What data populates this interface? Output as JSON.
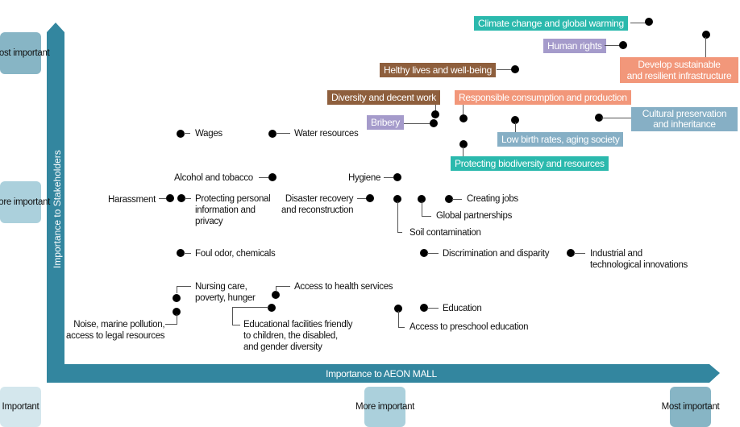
{
  "axes": {
    "y_label": "Importance to Stakeholders",
    "x_label": "Importance to AEON MALL",
    "y_levels": [
      "Most important",
      "More important",
      "Important"
    ],
    "x_levels": [
      "Important",
      "More important",
      "Most important"
    ]
  },
  "colors": {
    "axis": "#33869f",
    "level_most": "#87b5c5",
    "level_more": "#abd0dc",
    "level_important": "#d4e7ed",
    "teal": "#2bb9ad",
    "lavender": "#a59bcb",
    "brown": "#8e5f3d",
    "salmon": "#f2977a",
    "steel": "#86afc5"
  },
  "highlighted": {
    "climate": "Climate change and global warming",
    "human_rights": "Human rights",
    "infrastructure": "Develop sustainable\nand resilient infrastructure",
    "healthy": "Helthy lives and well-being",
    "diversity": "Diversity and decent work",
    "responsible": "Responsible consumption and production",
    "bribery": "Bribery",
    "cultural": "Cultural preservation\nand inheritance",
    "low_birth": "Low birth rates, aging society",
    "biodiversity": "Protecting biodiversity and resources"
  },
  "issues": {
    "wages": "Wages",
    "water": "Water resources",
    "alcohol": "Alcohol and tobacco",
    "hygiene": "Hygiene",
    "harassment": "Harassment",
    "privacy": "Protecting personal\ninformation and\nprivacy",
    "disaster": "Disaster recovery\nand reconstruction",
    "creating_jobs": "Creating jobs",
    "global_partnerships": "Global partnerships",
    "soil": "Soil contamination",
    "foul_odor": "Foul odor, chemicals",
    "discrimination": "Discrimination and disparity",
    "industrial": "Industrial and\ntechnological innovations",
    "nursing": "Nursing care,\npoverty, hunger",
    "health_services": "Access to health services",
    "noise": "Noise, marine pollution,\naccess to legal resources",
    "edu_facilities": "Educational facilities friendly\nto children, the disabled,\nand gender diversity",
    "education": "Education",
    "preschool": "Access to preschool education"
  }
}
